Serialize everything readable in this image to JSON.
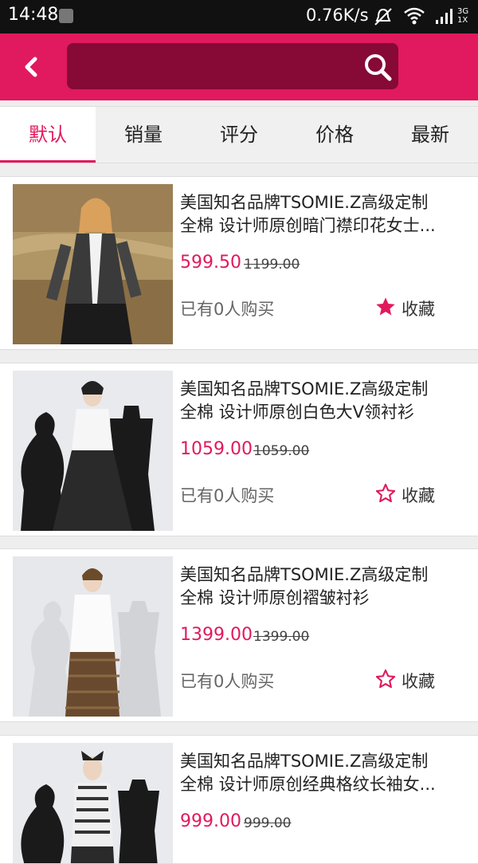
{
  "status_bar": {
    "time": "14:48",
    "net_speed": "0.76K/s",
    "network_type": "3G",
    "network_sub": "1X"
  },
  "header": {
    "search_placeholder": ""
  },
  "tabs": [
    {
      "label": "默认",
      "active": true
    },
    {
      "label": "销量",
      "active": false
    },
    {
      "label": "评分",
      "active": false
    },
    {
      "label": "价格",
      "active": false
    },
    {
      "label": "最新",
      "active": false
    }
  ],
  "products": [
    {
      "title_line1": "美国知名品牌TSOMIE.Z高级定制",
      "title_line2": "全棉 设计师原创暗门襟印花女士...",
      "price": "599.50",
      "original_price": "1199.00",
      "sold": "已有0人购买",
      "fav_label": "收藏",
      "favorited": true
    },
    {
      "title_line1": "美国知名品牌TSOMIE.Z高级定制",
      "title_line2": "全棉 设计师原创白色大V领衬衫",
      "price": "1059.00",
      "original_price": "1059.00",
      "sold": "已有0人购买",
      "fav_label": "收藏",
      "favorited": false
    },
    {
      "title_line1": "美国知名品牌TSOMIE.Z高级定制",
      "title_line2": "全棉 设计师原创褶皱衬衫",
      "price": "1399.00",
      "original_price": "1399.00",
      "sold": "已有0人购买",
      "fav_label": "收藏",
      "favorited": false
    },
    {
      "title_line1": "美国知名品牌TSOMIE.Z高级定制",
      "title_line2": "全棉 设计师原创经典格纹长袖女...",
      "price": "999.00",
      "original_price": "999.00",
      "sold": "",
      "fav_label": "",
      "favorited": false
    }
  ],
  "colors": {
    "accent": "#e1195e",
    "search_bg": "#870935"
  }
}
